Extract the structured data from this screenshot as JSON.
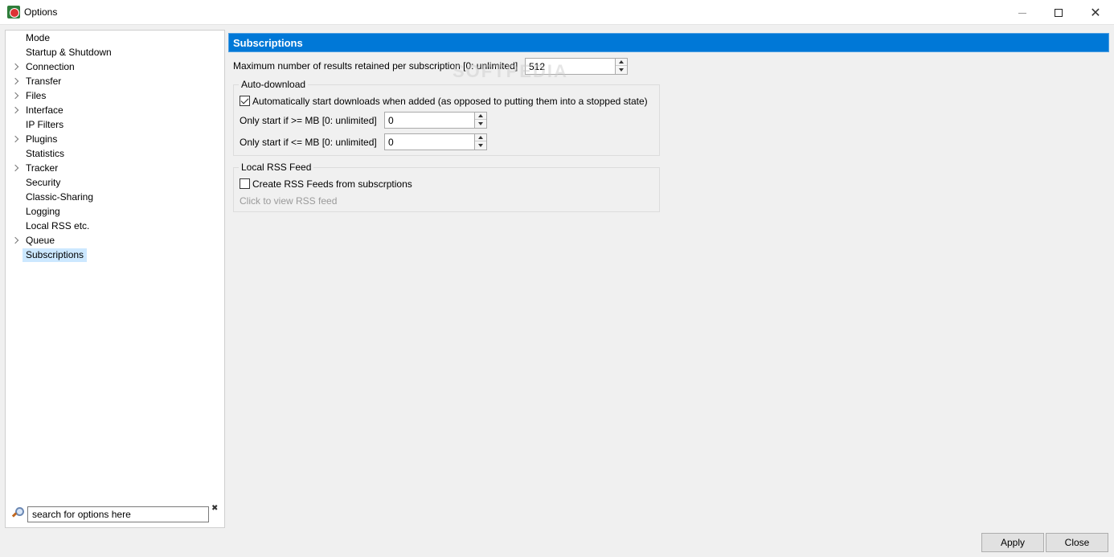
{
  "window": {
    "title": "Options"
  },
  "tree": {
    "items": [
      {
        "label": "Mode",
        "expandable": false
      },
      {
        "label": "Startup & Shutdown",
        "expandable": false
      },
      {
        "label": "Connection",
        "expandable": true
      },
      {
        "label": "Transfer",
        "expandable": true
      },
      {
        "label": "Files",
        "expandable": true
      },
      {
        "label": "Interface",
        "expandable": true
      },
      {
        "label": "IP Filters",
        "expandable": false
      },
      {
        "label": "Plugins",
        "expandable": true
      },
      {
        "label": "Statistics",
        "expandable": false
      },
      {
        "label": "Tracker",
        "expandable": true
      },
      {
        "label": "Security",
        "expandable": false
      },
      {
        "label": "Classic-Sharing",
        "expandable": false
      },
      {
        "label": "Logging",
        "expandable": false
      },
      {
        "label": "Local RSS etc.",
        "expandable": false
      },
      {
        "label": "Queue",
        "expandable": true
      },
      {
        "label": "Subscriptions",
        "expandable": false,
        "selected": true
      }
    ],
    "search_value": "search for options here"
  },
  "panel": {
    "title": "Subscriptions",
    "max_results_label": "Maximum number of results retained per subscription [0: unlimited]",
    "max_results_value": "512",
    "auto_download": {
      "title": "Auto-download",
      "auto_start_label": "Automatically start downloads when added (as opposed to putting them into a stopped state)",
      "auto_start_checked": true,
      "min_mb_label": "Only start if >= MB [0: unlimited]",
      "min_mb_value": "0",
      "max_mb_label": "Only start if <= MB [0: unlimited]",
      "max_mb_value": "0"
    },
    "rss": {
      "title": "Local RSS Feed",
      "create_label": "Create RSS Feeds from subscrptions",
      "create_checked": false,
      "view_link": "Click to view RSS feed"
    }
  },
  "buttons": {
    "apply": "Apply",
    "close": "Close"
  }
}
